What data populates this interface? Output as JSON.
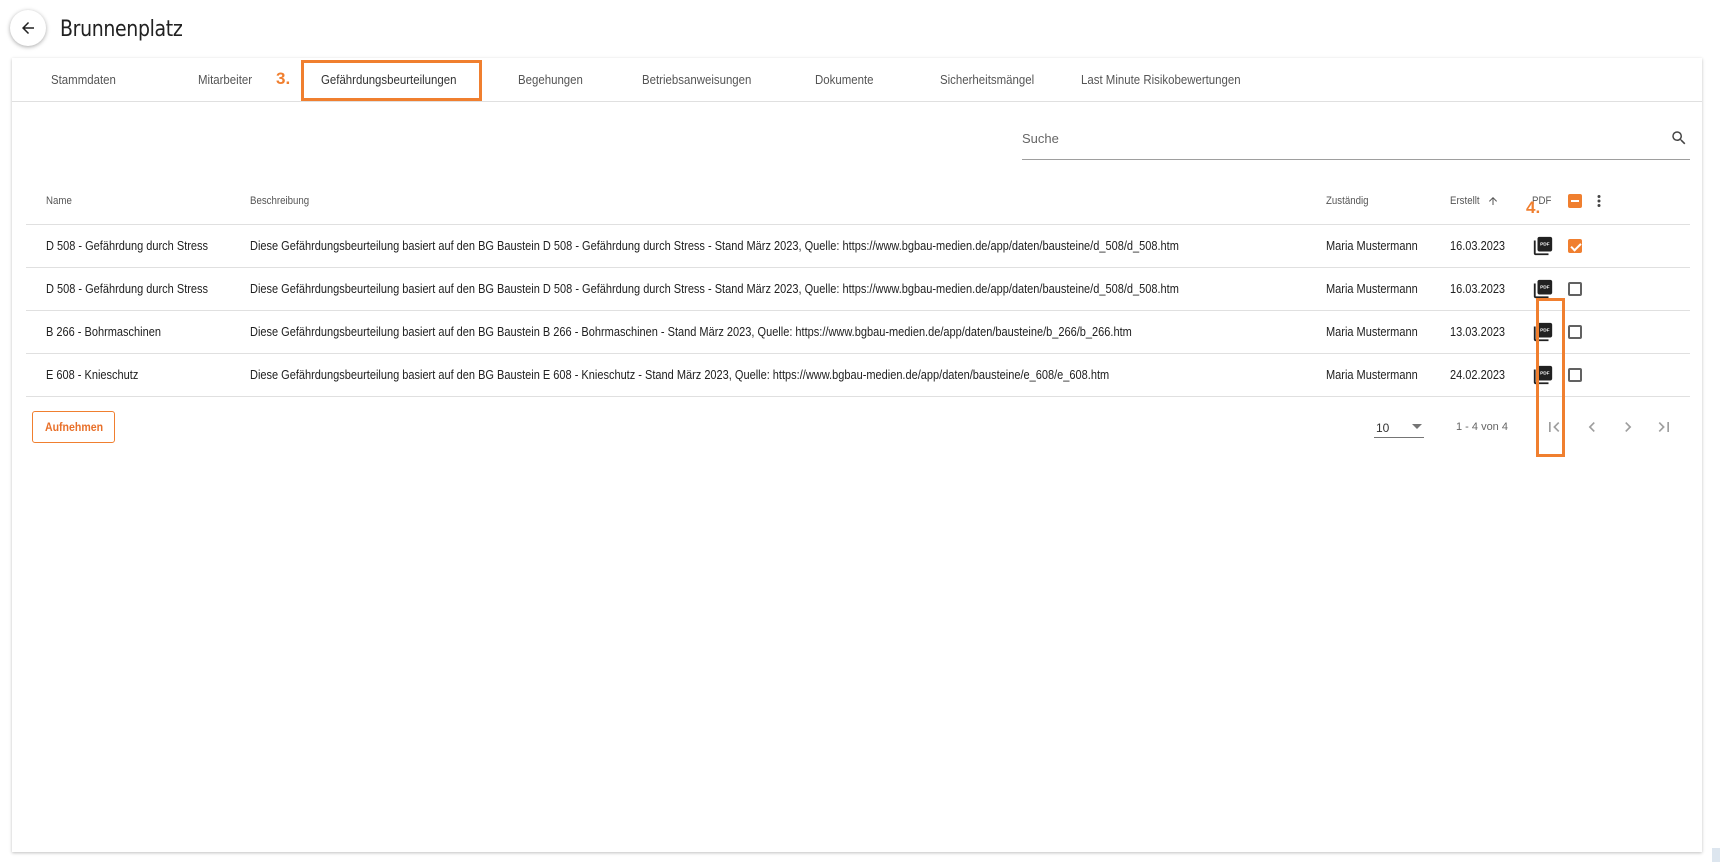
{
  "header": {
    "title": "Brunnenplatz"
  },
  "tabs": [
    {
      "label": "Stammdaten"
    },
    {
      "label": "Mitarbeiter"
    },
    {
      "label": "Gefährdungsbeurteilungen"
    },
    {
      "label": "Begehungen"
    },
    {
      "label": "Betriebsanweisungen"
    },
    {
      "label": "Dokumente"
    },
    {
      "label": "Sicherheitsmängel"
    },
    {
      "label": "Last Minute Risikobewertungen"
    }
  ],
  "annotations": {
    "step3": "3.",
    "step4": "4.",
    "color": "#f07f2f"
  },
  "search": {
    "placeholder": "Suche"
  },
  "table": {
    "headers": {
      "name": "Name",
      "beschreibung": "Beschreibung",
      "zustaendig": "Zuständig",
      "erstellt": "Erstellt",
      "pdf": "PDF"
    },
    "rows": [
      {
        "name": "D 508 - Gefährdung durch Stress",
        "beschreibung": "Diese Gefährdungsbeurteilung basiert auf den BG Baustein D 508 - Gefährdung durch Stress - Stand März 2023, Quelle: https://www.bgbau-medien.de/app/daten/bausteine/d_508/d_508.htm",
        "zustaendig": "Maria Mustermann",
        "erstellt": "16.03.2023",
        "selected": true
      },
      {
        "name": "D 508 - Gefährdung durch Stress",
        "beschreibung": "Diese Gefährdungsbeurteilung basiert auf den BG Baustein D 508 - Gefährdung durch Stress - Stand März 2023, Quelle: https://www.bgbau-medien.de/app/daten/bausteine/d_508/d_508.htm",
        "zustaendig": "Maria Mustermann",
        "erstellt": "16.03.2023",
        "selected": false
      },
      {
        "name": "B 266 - Bohrmaschinen",
        "beschreibung": "Diese Gefährdungsbeurteilung basiert auf den BG Baustein B 266 - Bohrmaschinen - Stand März 2023, Quelle: https://www.bgbau-medien.de/app/daten/bausteine/b_266/b_266.htm",
        "zustaendig": "Maria Mustermann",
        "erstellt": "13.03.2023",
        "selected": false
      },
      {
        "name": "E 608 - Knieschutz",
        "beschreibung": "Diese Gefährdungsbeurteilung basiert auf den BG Baustein E 608 - Knieschutz - Stand März 2023, Quelle: https://www.bgbau-medien.de/app/daten/bausteine/e_608/e_608.htm",
        "zustaendig": "Maria Mustermann",
        "erstellt": "24.02.2023",
        "selected": false
      }
    ]
  },
  "actions": {
    "add_label": "Aufnehmen"
  },
  "paginator": {
    "page_size": "10",
    "range": "1 - 4 von 4"
  },
  "colors": {
    "accent": "#f07f2f",
    "text": "#212121",
    "muted": "#555555"
  },
  "icons": [
    "arrow-left-icon",
    "search-icon",
    "sort-up-icon",
    "pdf-icon",
    "more-vert-icon",
    "first-page-icon",
    "prev-page-icon",
    "next-page-icon",
    "last-page-icon"
  ]
}
